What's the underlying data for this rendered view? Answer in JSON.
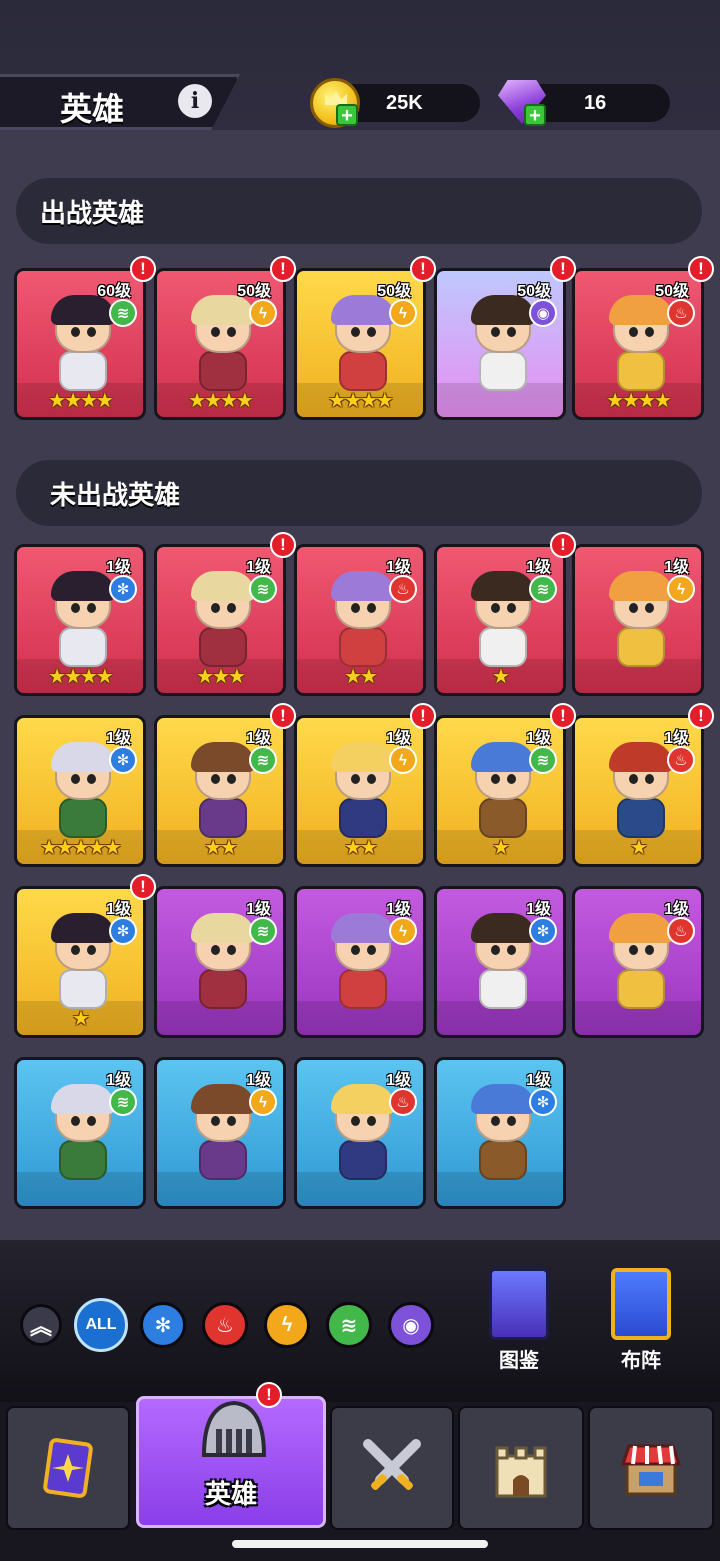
{
  "header": {
    "title": "英雄",
    "coins": "25K",
    "gems": "16"
  },
  "sections": {
    "active_title": "出战英雄",
    "inactive_title": "未出战英雄"
  },
  "active_heroes": [
    {
      "level": "60级",
      "element": "wind",
      "stars": 4,
      "color": "red",
      "alert": true
    },
    {
      "level": "50级",
      "element": "lightning",
      "stars": 4,
      "color": "red",
      "alert": true
    },
    {
      "level": "50级",
      "element": "lightning",
      "stars": 4,
      "color": "yellow",
      "alert": true
    },
    {
      "level": "50级",
      "element": "eye",
      "stars": 0,
      "color": "pink",
      "alert": true
    },
    {
      "level": "50级",
      "element": "fire",
      "stars": 4,
      "color": "red",
      "alert": true
    }
  ],
  "inactive_heroes": [
    {
      "level": "1级",
      "element": "ice",
      "stars": 4,
      "color": "red",
      "alert": false
    },
    {
      "level": "1级",
      "element": "wind",
      "stars": 3,
      "color": "red",
      "alert": true
    },
    {
      "level": "1级",
      "element": "fire",
      "stars": 2,
      "color": "red",
      "alert": false
    },
    {
      "level": "1级",
      "element": "wind",
      "stars": 1,
      "color": "red",
      "alert": true
    },
    {
      "level": "1级",
      "element": "lightning",
      "stars": 0,
      "color": "red",
      "alert": false
    },
    {
      "level": "1级",
      "element": "ice",
      "stars": 5,
      "color": "yellow",
      "alert": false
    },
    {
      "level": "1级",
      "element": "wind",
      "stars": 2,
      "color": "yellow",
      "alert": true
    },
    {
      "level": "1级",
      "element": "lightning",
      "stars": 2,
      "color": "yellow",
      "alert": true
    },
    {
      "level": "1级",
      "element": "wind",
      "stars": 1,
      "color": "yellow",
      "alert": true
    },
    {
      "level": "1级",
      "element": "fire",
      "stars": 1,
      "color": "yellow",
      "alert": true
    },
    {
      "level": "1级",
      "element": "ice",
      "stars": 1,
      "color": "yellow",
      "alert": true
    },
    {
      "level": "1级",
      "element": "wind",
      "stars": 0,
      "color": "purple",
      "alert": false
    },
    {
      "level": "1级",
      "element": "lightning",
      "stars": 0,
      "color": "purple",
      "alert": false
    },
    {
      "level": "1级",
      "element": "ice",
      "stars": 0,
      "color": "purple",
      "alert": false
    },
    {
      "level": "1级",
      "element": "fire",
      "stars": 0,
      "color": "purple",
      "alert": false
    },
    {
      "level": "1级",
      "element": "wind",
      "stars": 0,
      "color": "blue",
      "alert": false
    },
    {
      "level": "1级",
      "element": "lightning",
      "stars": 0,
      "color": "blue",
      "alert": false
    },
    {
      "level": "1级",
      "element": "fire",
      "stars": 0,
      "color": "blue",
      "alert": false
    },
    {
      "level": "1级",
      "element": "ice",
      "stars": 0,
      "color": "blue",
      "alert": false
    }
  ],
  "filters": {
    "all_label": "ALL",
    "items": [
      "ice",
      "fire",
      "lightning",
      "wind",
      "eye"
    ]
  },
  "side_buttons": {
    "codex": "图鉴",
    "formation": "布阵"
  },
  "nav": {
    "active_label": "英雄",
    "tabs": [
      "cards-icon",
      "heroes-helmet-icon",
      "battle-swords-icon",
      "castle-icon",
      "shop-icon"
    ]
  },
  "colors": {
    "wind": "#42b84a",
    "lightning": "#f2a81a",
    "fire": "#e0352e",
    "ice": "#2e7de0",
    "eye": "#7e52d8"
  }
}
